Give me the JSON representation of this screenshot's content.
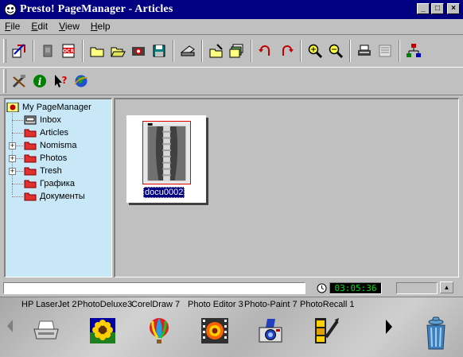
{
  "window": {
    "title": "Presto! PageManager - Articles",
    "controls": {
      "minimize": "_",
      "maximize": "□",
      "close": "×"
    }
  },
  "menu": {
    "items": [
      {
        "label": "File",
        "accel": "F"
      },
      {
        "label": "Edit",
        "accel": "E"
      },
      {
        "label": "View",
        "accel": "V"
      },
      {
        "label": "Help",
        "accel": "H"
      }
    ]
  },
  "toolbar1": {
    "buttons": [
      "acquire-image-icon",
      "scanner-setup-icon",
      "ocr-icon",
      "new-folder-icon",
      "open-folder-icon",
      "photo-icon",
      "save-icon",
      "scan-icon",
      "import-icon",
      "stack-icon",
      "rotate-left-icon",
      "rotate-right-icon",
      "zoom-in-icon",
      "zoom-out-icon",
      "print-icon",
      "fax-icon",
      "arrange-icon"
    ]
  },
  "toolbar2": {
    "buttons": [
      "tools-icon",
      "info-icon",
      "whats-this-icon",
      "web-icon"
    ]
  },
  "tree": {
    "root": "My PageManager",
    "items": [
      {
        "label": "Inbox",
        "icon": "inbox-icon",
        "expandable": false
      },
      {
        "label": "Articles",
        "icon": "folder-icon",
        "expandable": false
      },
      {
        "label": "Nomisma",
        "icon": "folder-icon",
        "expandable": true
      },
      {
        "label": "Photos",
        "icon": "folder-icon",
        "expandable": true
      },
      {
        "label": "Tresh",
        "icon": "folder-icon",
        "expandable": true
      },
      {
        "label": "Графика",
        "icon": "folder-icon",
        "expandable": false
      },
      {
        "label": "Документы",
        "icon": "folder-icon",
        "expandable": false
      }
    ]
  },
  "document": {
    "thumbnail_label": "docu0002"
  },
  "status": {
    "clock": "03:05:36"
  },
  "launcher": {
    "apps": [
      {
        "name": "HP LaserJet 2",
        "icon": "printer-icon"
      },
      {
        "name": "PhotoDeluxe3",
        "icon": "sunflower-icon"
      },
      {
        "name": "CorelDraw 7",
        "icon": "balloon-icon"
      },
      {
        "name": "Photo Editor 3",
        "icon": "film-flower-icon"
      },
      {
        "name": "Photo-Paint 7",
        "icon": "camera-icon"
      },
      {
        "name": "PhotoRecall 1",
        "icon": "filmstrip-icon"
      }
    ]
  },
  "colors": {
    "title_bar": "#000080",
    "tree_background": "#c8e8f8",
    "folder": "#e03030",
    "clock_text": "#00e000"
  }
}
